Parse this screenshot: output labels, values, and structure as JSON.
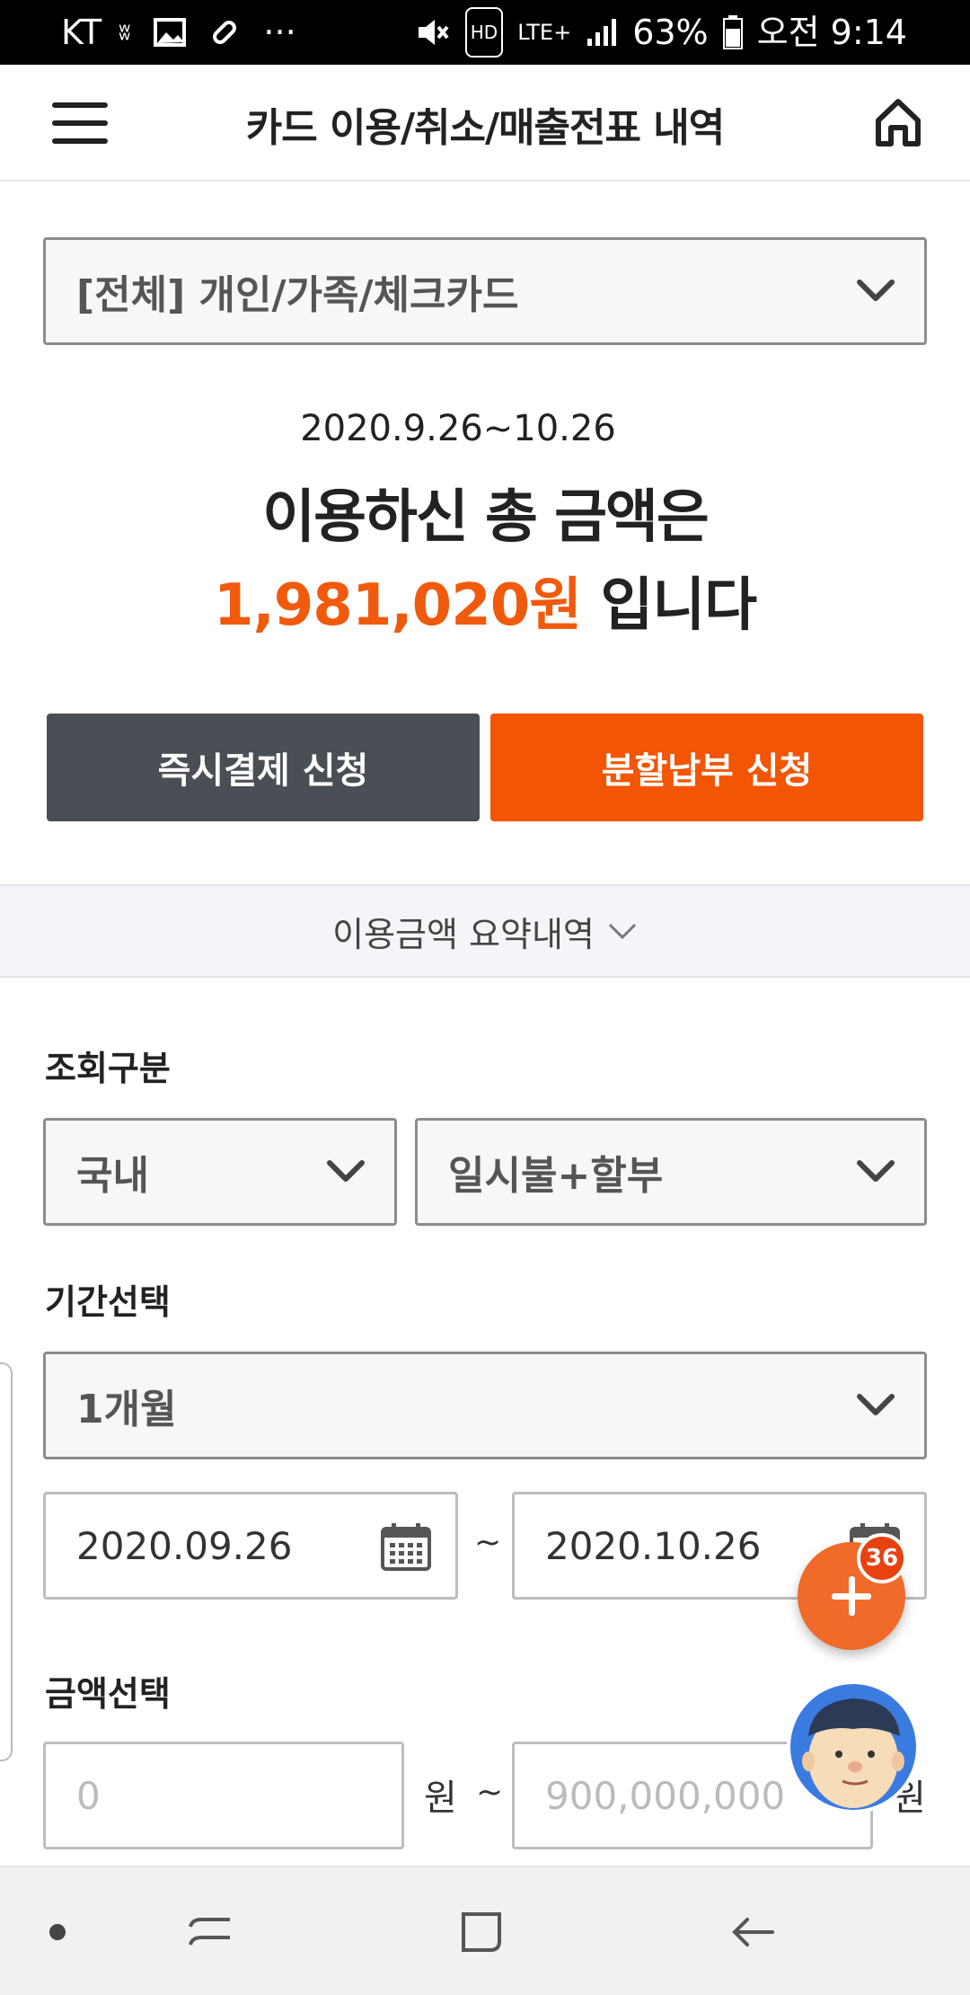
{
  "status_bar": {
    "carrier": "KT",
    "battery": "63%",
    "time": "오전 9:14",
    "network": "LTE+",
    "hd": "HD"
  },
  "header": {
    "title": "카드 이용/취소/매출전표 내역"
  },
  "card_select": {
    "value": "[전체] 개인/가족/체크카드"
  },
  "summary": {
    "period": "2020.9.26~10.26",
    "line1": "이용하신 총 금액은",
    "amount": "1,981,020원",
    "suffix": "입니다"
  },
  "buttons": {
    "instant_pay": "즉시결제 신청",
    "installment": "분할납부 신청"
  },
  "summary_toggle": {
    "label": "이용금액 요약내역"
  },
  "inquiry": {
    "label": "조회구분",
    "region": "국내",
    "payment_type": "일시불+할부"
  },
  "period_select": {
    "label": "기간선택",
    "value": "1개월",
    "start_date": "2020.09.26",
    "end_date": "2020.10.26",
    "separator": "~"
  },
  "amount_select": {
    "label": "금액선택",
    "min_placeholder": "0",
    "max_placeholder": "900,000,000",
    "unit": "원",
    "separator": "~"
  },
  "fab": {
    "badge": "36"
  },
  "colors": {
    "accent": "#f25503",
    "dark_button": "#4a4f55",
    "amount_text": "#f05a0d"
  }
}
